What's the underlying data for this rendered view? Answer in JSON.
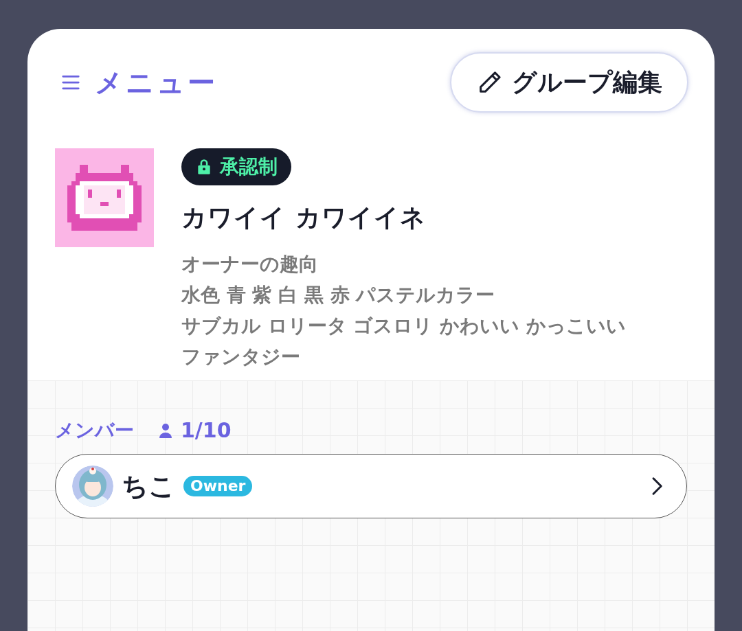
{
  "header": {
    "menu_label": "メニュー",
    "edit_button": "グループ編集"
  },
  "group": {
    "badge": "承認制",
    "name": "カワイイ カワイイネ",
    "description": [
      "オーナーの趣向",
      "水色 青 紫 白 黒 赤 パステルカラー",
      "サブカル ロリータ ゴスロリ かわいい かっこいい",
      "ファンタジー"
    ]
  },
  "members": {
    "label": "メンバー",
    "count": "1/10",
    "list": [
      {
        "name": "ちこ",
        "role": "Owner"
      }
    ]
  }
}
